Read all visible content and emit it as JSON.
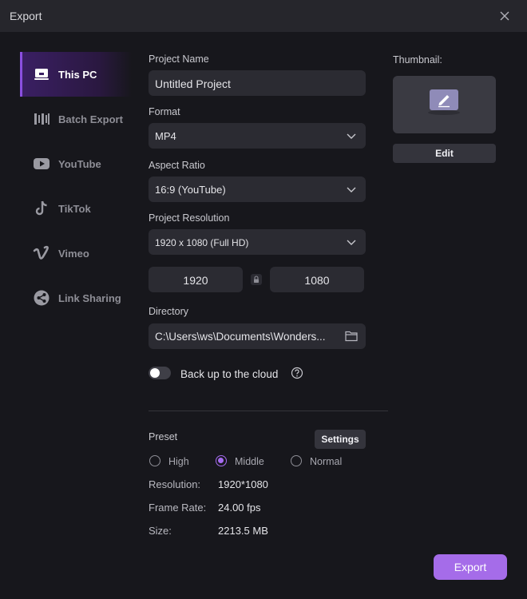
{
  "window": {
    "title": "Export"
  },
  "sidebar": {
    "items": [
      {
        "label": "This PC",
        "icon": "monitor-icon",
        "active": true
      },
      {
        "label": "Batch Export",
        "icon": "batch-icon",
        "active": false
      },
      {
        "label": "YouTube",
        "icon": "youtube-icon",
        "active": false
      },
      {
        "label": "TikTok",
        "icon": "tiktok-icon",
        "active": false
      },
      {
        "label": "Vimeo",
        "icon": "vimeo-icon",
        "active": false
      },
      {
        "label": "Link Sharing",
        "icon": "share-icon",
        "active": false
      }
    ]
  },
  "form": {
    "project_name_label": "Project Name",
    "project_name": "Untitled Project",
    "format_label": "Format",
    "format": "MP4",
    "aspect_label": "Aspect Ratio",
    "aspect": "16:9 (YouTube)",
    "resolution_label": "Project Resolution",
    "resolution": "1920 x 1080 (Full HD)",
    "width": "1920",
    "height": "1080",
    "directory_label": "Directory",
    "directory": "C:\\Users\\ws\\Documents\\Wonders...",
    "cloud_label": "Back up to the cloud",
    "cloud_enabled": false
  },
  "thumbnail": {
    "label": "Thumbnail:",
    "edit_label": "Edit"
  },
  "preset": {
    "label": "Preset",
    "settings_label": "Settings",
    "options": [
      "High",
      "Middle",
      "Normal"
    ],
    "selected": "Middle"
  },
  "info": {
    "resolution_label": "Resolution:",
    "resolution": "1920*1080",
    "framerate_label": "Frame Rate:",
    "framerate": "24.00 fps",
    "size_label": "Size:",
    "size": "2213.5 MB"
  },
  "actions": {
    "export_label": "Export"
  },
  "colors": {
    "accent": "#a56ce9",
    "background": "#17171c",
    "field": "#2b2b32"
  }
}
